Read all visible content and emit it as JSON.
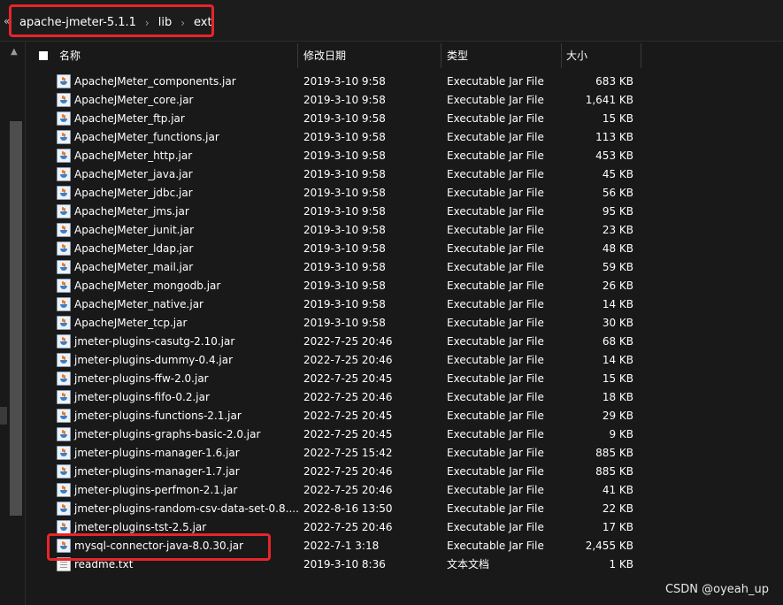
{
  "breadcrumb": {
    "lead": "«",
    "items": [
      "apache-jmeter-5.1.1",
      "lib",
      "ext"
    ],
    "separator": "›"
  },
  "columns": {
    "name": "名称",
    "date": "修改日期",
    "type": "类型",
    "size": "大小"
  },
  "files": [
    {
      "name": "ApacheJMeter_components.jar",
      "date": "2019-3-10 9:58",
      "type": "Executable Jar File",
      "size": "683 KB"
    },
    {
      "name": "ApacheJMeter_core.jar",
      "date": "2019-3-10 9:58",
      "type": "Executable Jar File",
      "size": "1,641 KB"
    },
    {
      "name": "ApacheJMeter_ftp.jar",
      "date": "2019-3-10 9:58",
      "type": "Executable Jar File",
      "size": "15 KB"
    },
    {
      "name": "ApacheJMeter_functions.jar",
      "date": "2019-3-10 9:58",
      "type": "Executable Jar File",
      "size": "113 KB"
    },
    {
      "name": "ApacheJMeter_http.jar",
      "date": "2019-3-10 9:58",
      "type": "Executable Jar File",
      "size": "453 KB"
    },
    {
      "name": "ApacheJMeter_java.jar",
      "date": "2019-3-10 9:58",
      "type": "Executable Jar File",
      "size": "45 KB"
    },
    {
      "name": "ApacheJMeter_jdbc.jar",
      "date": "2019-3-10 9:58",
      "type": "Executable Jar File",
      "size": "56 KB"
    },
    {
      "name": "ApacheJMeter_jms.jar",
      "date": "2019-3-10 9:58",
      "type": "Executable Jar File",
      "size": "95 KB"
    },
    {
      "name": "ApacheJMeter_junit.jar",
      "date": "2019-3-10 9:58",
      "type": "Executable Jar File",
      "size": "23 KB"
    },
    {
      "name": "ApacheJMeter_ldap.jar",
      "date": "2019-3-10 9:58",
      "type": "Executable Jar File",
      "size": "48 KB"
    },
    {
      "name": "ApacheJMeter_mail.jar",
      "date": "2019-3-10 9:58",
      "type": "Executable Jar File",
      "size": "59 KB"
    },
    {
      "name": "ApacheJMeter_mongodb.jar",
      "date": "2019-3-10 9:58",
      "type": "Executable Jar File",
      "size": "26 KB"
    },
    {
      "name": "ApacheJMeter_native.jar",
      "date": "2019-3-10 9:58",
      "type": "Executable Jar File",
      "size": "14 KB"
    },
    {
      "name": "ApacheJMeter_tcp.jar",
      "date": "2019-3-10 9:58",
      "type": "Executable Jar File",
      "size": "30 KB"
    },
    {
      "name": "jmeter-plugins-casutg-2.10.jar",
      "date": "2022-7-25 20:46",
      "type": "Executable Jar File",
      "size": "68 KB"
    },
    {
      "name": "jmeter-plugins-dummy-0.4.jar",
      "date": "2022-7-25 20:46",
      "type": "Executable Jar File",
      "size": "14 KB"
    },
    {
      "name": "jmeter-plugins-ffw-2.0.jar",
      "date": "2022-7-25 20:45",
      "type": "Executable Jar File",
      "size": "15 KB"
    },
    {
      "name": "jmeter-plugins-fifo-0.2.jar",
      "date": "2022-7-25 20:46",
      "type": "Executable Jar File",
      "size": "18 KB"
    },
    {
      "name": "jmeter-plugins-functions-2.1.jar",
      "date": "2022-7-25 20:45",
      "type": "Executable Jar File",
      "size": "29 KB"
    },
    {
      "name": "jmeter-plugins-graphs-basic-2.0.jar",
      "date": "2022-7-25 20:45",
      "type": "Executable Jar File",
      "size": "9 KB"
    },
    {
      "name": "jmeter-plugins-manager-1.6.jar",
      "date": "2022-7-25 15:42",
      "type": "Executable Jar File",
      "size": "885 KB"
    },
    {
      "name": "jmeter-plugins-manager-1.7.jar",
      "date": "2022-7-25 20:46",
      "type": "Executable Jar File",
      "size": "885 KB"
    },
    {
      "name": "jmeter-plugins-perfmon-2.1.jar",
      "date": "2022-7-25 20:46",
      "type": "Executable Jar File",
      "size": "41 KB"
    },
    {
      "name": "jmeter-plugins-random-csv-data-set-0.8....",
      "date": "2022-8-16 13:50",
      "type": "Executable Jar File",
      "size": "22 KB"
    },
    {
      "name": "jmeter-plugins-tst-2.5.jar",
      "date": "2022-7-25 20:46",
      "type": "Executable Jar File",
      "size": "17 KB"
    },
    {
      "name": "mysql-connector-java-8.0.30.jar",
      "date": "2022-7-1 3:18",
      "type": "Executable Jar File",
      "size": "2,455 KB"
    },
    {
      "name": "readme.txt",
      "date": "2019-3-10 8:36",
      "type": "文本文档",
      "size": "1 KB"
    }
  ],
  "watermark": "CSDN @oyeah_up",
  "colors": {
    "background": "#191919",
    "text": "#ffffff",
    "highlight_box": "#e8242b"
  }
}
